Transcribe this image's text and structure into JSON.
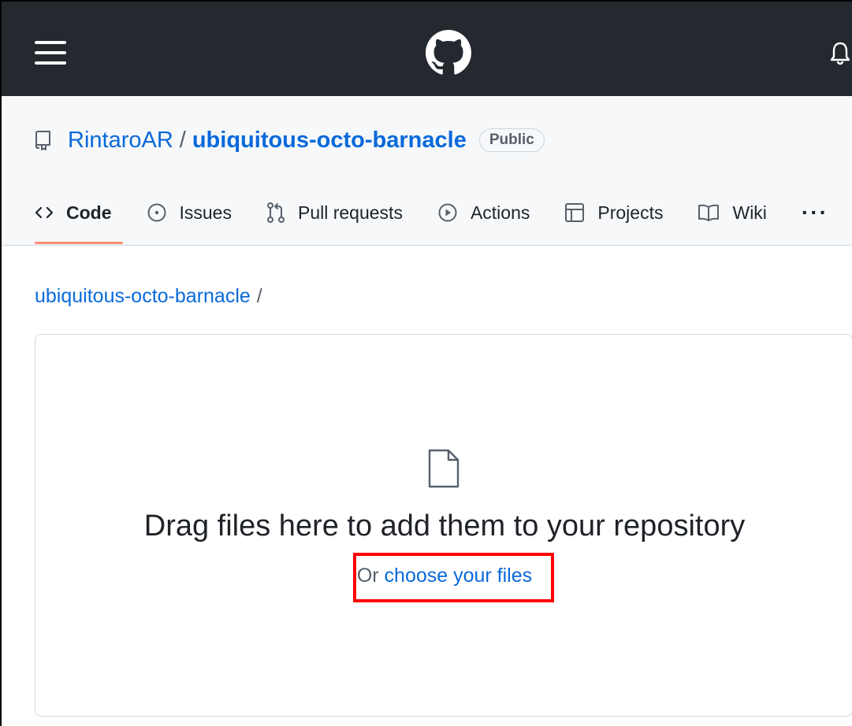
{
  "header": {
    "menu_icon": "hamburger-menu-icon",
    "logo_icon": "github-logo-icon",
    "notifications_icon": "bell-icon",
    "background": "#24292f"
  },
  "repo": {
    "icon": "repo-icon",
    "owner": "RintaroAR",
    "separator": "/",
    "name": "ubiquitous-octo-barnacle",
    "visibility": "Public"
  },
  "tabs": [
    {
      "label": "Code",
      "icon": "code-icon",
      "active": true
    },
    {
      "label": "Issues",
      "icon": "issue-opened-icon",
      "active": false
    },
    {
      "label": "Pull requests",
      "icon": "git-pull-request-icon",
      "active": false
    },
    {
      "label": "Actions",
      "icon": "play-icon",
      "active": false
    },
    {
      "label": "Projects",
      "icon": "table-icon",
      "active": false
    },
    {
      "label": "Wiki",
      "icon": "book-icon",
      "active": false
    }
  ],
  "more_label": "···",
  "breadcrumb": {
    "repo": "ubiquitous-octo-barnacle",
    "separator": "/"
  },
  "upload": {
    "icon": "file-icon",
    "title": "Drag files here to add them to your repository",
    "sub_prefix": "Or ",
    "choose_link": "choose your files"
  },
  "colors": {
    "link": "#0969da",
    "active_tab_underline": "#fd8c73",
    "highlight_box": "#ff0000"
  }
}
